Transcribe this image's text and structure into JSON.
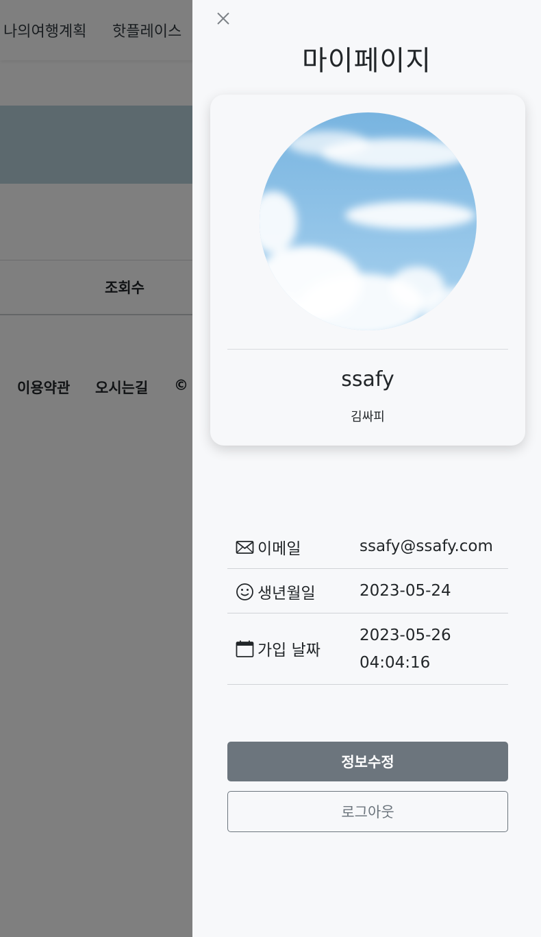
{
  "background": {
    "nav_items": [
      "나의여행계획",
      "핫플레이스"
    ],
    "table_header": "조회수",
    "footer_items": [
      "이용약관",
      "오시는길",
      "©"
    ]
  },
  "mypage": {
    "title": "마이페이지",
    "close_icon": "close-icon",
    "user_id": "ssafy",
    "user_name": "김싸피",
    "info": [
      {
        "icon": "envelope-icon",
        "label": "이메일",
        "value": "ssafy@ssafy.com"
      },
      {
        "icon": "smile-icon",
        "label": "생년월일",
        "value": "2023-05-24"
      },
      {
        "icon": "calendar-icon",
        "label": "가입 날짜",
        "value": "2023-05-26 04:04:16"
      }
    ],
    "edit_button": "정보수정",
    "logout_button": "로그아웃"
  }
}
